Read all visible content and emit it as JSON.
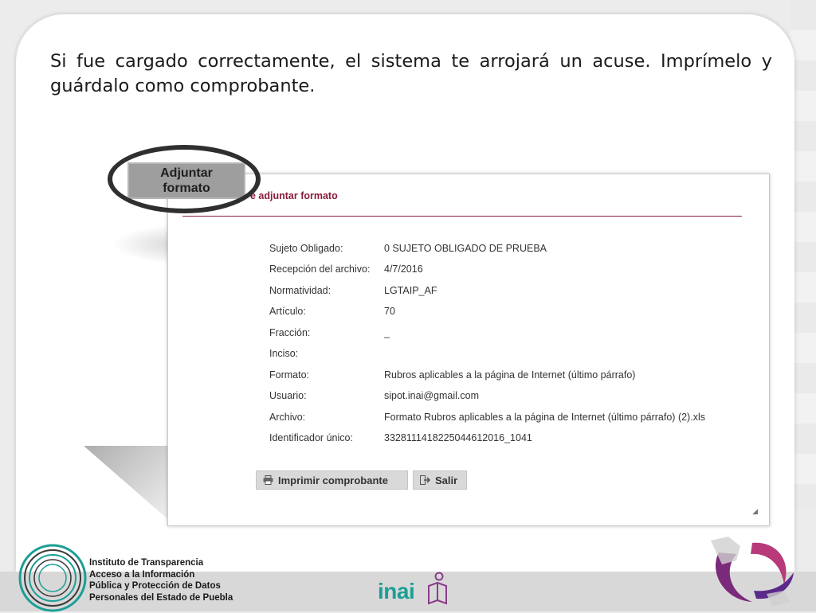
{
  "intro": {
    "text": "Si fue cargado correctamente, el sistema te arrojará un acuse. Imprímelo y guárdalo como comprobante."
  },
  "attach_button": {
    "line1": "Adjuntar",
    "line2": "formato"
  },
  "acknowledgment": {
    "title": "e adjuntar formato",
    "fields": [
      {
        "label": "Sujeto Obligado:",
        "value": "0 SUJETO OBLIGADO DE PRUEBA"
      },
      {
        "label": "Recepción del archivo:",
        "value": "4/7/2016"
      },
      {
        "label": "Normatividad:",
        "value": "LGTAIP_AF"
      },
      {
        "label": "Artículo:",
        "value": "70"
      },
      {
        "label": "Fracción:",
        "value": "_"
      },
      {
        "label": "Inciso:",
        "value": ""
      },
      {
        "label": "Formato:",
        "value": "Rubros aplicables a la página de Internet (último párrafo)"
      },
      {
        "label": "Usuario:",
        "value": "sipot.inai@gmail.com"
      },
      {
        "label": "Archivo:",
        "value": "Formato Rubros aplicables a la página de Internet (último párrafo) (2).xls"
      },
      {
        "label": "Identificador único:",
        "value": "332811141822504461201​6_1041"
      }
    ],
    "buttons": {
      "print": "Imprimir comprobante",
      "exit": "Salir"
    }
  },
  "footer": {
    "institute_lines": [
      "Instituto de Transparencia",
      "Acceso a la Información",
      "Pública y Protección de Datos",
      "Personales del Estado de Puebla"
    ],
    "inai": "inai"
  },
  "colors": {
    "accent": "#8a1c3c",
    "inai_teal": "#1c9e96",
    "button_gray": "#d9d9d9"
  }
}
